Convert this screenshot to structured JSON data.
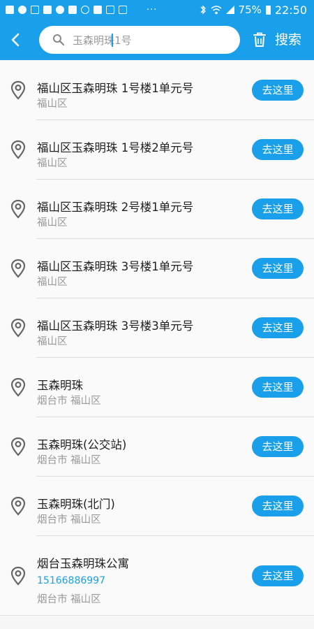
{
  "status_bar": {
    "battery": "75%",
    "time": "22:50",
    "dots": "···"
  },
  "header": {
    "search_value": "玉森明珠1号",
    "search_label": "搜索"
  },
  "colors": {
    "accent": "#1aa0ea",
    "title_text": "#222222",
    "sub_text": "#999999"
  },
  "results": [
    {
      "title": "福山区玉森明珠  1号楼1单元号",
      "sub": "福山区",
      "button": "去这里"
    },
    {
      "title": "福山区玉森明珠  1号楼2单元号",
      "sub": "福山区",
      "button": "去这里"
    },
    {
      "title": "福山区玉森明珠  2号楼1单元号",
      "sub": "福山区",
      "button": "去这里"
    },
    {
      "title": "福山区玉森明珠  3号楼1单元号",
      "sub": "福山区",
      "button": "去这里"
    },
    {
      "title": "福山区玉森明珠  3号楼3单元号",
      "sub": "福山区",
      "button": "去这里"
    },
    {
      "title": "玉森明珠",
      "sub": "烟台市  福山区",
      "button": "去这里"
    },
    {
      "title": "玉森明珠(公交站)",
      "sub": "烟台市  福山区",
      "button": "去这里"
    },
    {
      "title": "玉森明珠(北门)",
      "sub": "烟台市  福山区",
      "button": "去这里"
    },
    {
      "title": "烟台玉森明珠公寓",
      "phone": "15166886997",
      "sub": "烟台市  福山区",
      "button": "去这里"
    }
  ]
}
